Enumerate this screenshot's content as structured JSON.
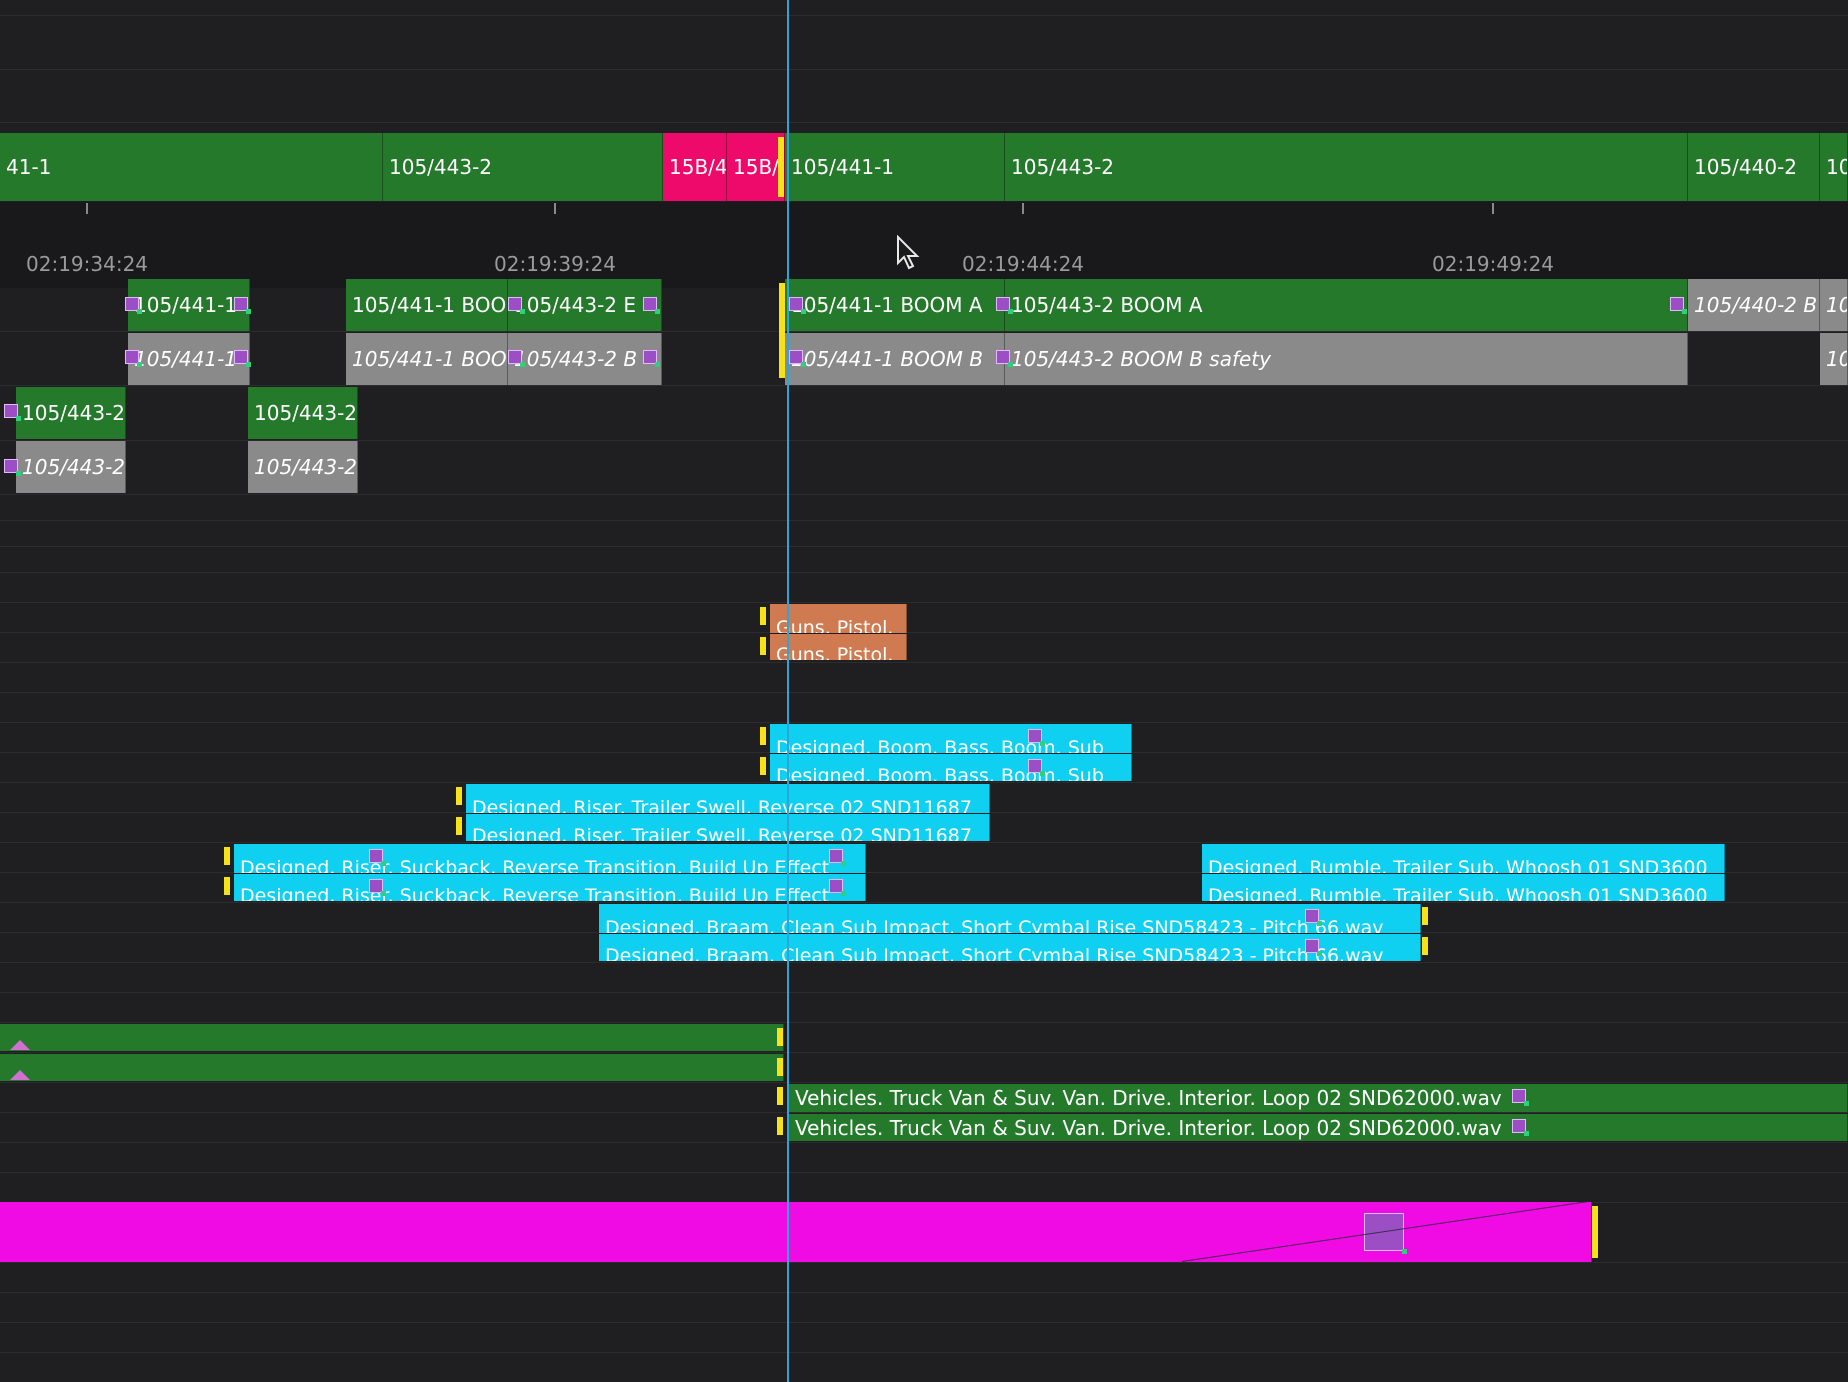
{
  "timeline": {
    "timecodes": [
      "02:19:34:24",
      "02:19:39:24",
      "02:19:44:24",
      "02:19:49:24"
    ],
    "video_track": {
      "clips": [
        "41-1",
        "105/443-2",
        "15B/4",
        "15B/",
        "105/441-1",
        "105/443-2",
        "105/440-2",
        "10"
      ]
    },
    "audio_a1": {
      "clips": [
        "105/441-1",
        "105/441-1  BOO",
        "105/443-2  E",
        "105/441-1  BOOM A",
        "105/443-2  BOOM A",
        "105/440-2  B",
        "10"
      ]
    },
    "audio_a2": {
      "clips": [
        "105/441-1",
        "105/441-1  BOO",
        "105/443-2  B",
        "105/441-1  BOOM B",
        "105/443-2  BOOM B safety",
        "10"
      ]
    },
    "audio_a3": {
      "clips": [
        "105/443-2",
        "105/443-2"
      ]
    },
    "audio_a4": {
      "clips": [
        "105/443-2",
        "105/443-2"
      ]
    },
    "sfx": {
      "guns": [
        "Guns. Pistol.",
        "Guns. Pistol."
      ],
      "boom": [
        "Designed. Boom. Bass. Boom. Sub",
        "Designed. Boom. Bass. Boom. Sub"
      ],
      "riser": [
        "Designed. Riser. Trailer Swell. Reverse 02 SND11687",
        "Designed. Riser. Trailer Swell. Reverse 02 SND11687"
      ],
      "suckback": [
        "Designed. Riser. Suckback. Reverse Transition. Build Up Effect",
        "Designed. Riser. Suckback. Reverse Transition. Build Up Effect"
      ],
      "rumble": [
        "Designed. Rumble. Trailer Sub. Whoosh 01 SND3600",
        "Designed. Rumble. Trailer Sub. Whoosh 01 SND3600"
      ],
      "braam": [
        "Designed. Braam. Clean Sub Impact. Short Cymbal Rise SND58423 - Pitch 66.wav",
        "Designed. Braam. Clean Sub Impact. Short Cymbal Rise SND58423 - Pitch 66.wav"
      ],
      "vehicles": [
        "Vehicles. Truck Van & Suv. Van. Drive. Interior. Loop 02 SND62000.wav",
        "Vehicles. Truck Van & Suv. Van. Drive. Interior. Loop 02 SND62000.wav"
      ]
    }
  },
  "colors": {
    "background": "#1f1f21",
    "clip_green": "#247a2a",
    "clip_grey": "#8a8a8a",
    "clip_red": "#ee0a6a",
    "clip_orange": "#cf7a50",
    "clip_cyan": "#10d0f2",
    "clip_magenta": "#f00ae4",
    "playhead": "#2aa7d8"
  }
}
